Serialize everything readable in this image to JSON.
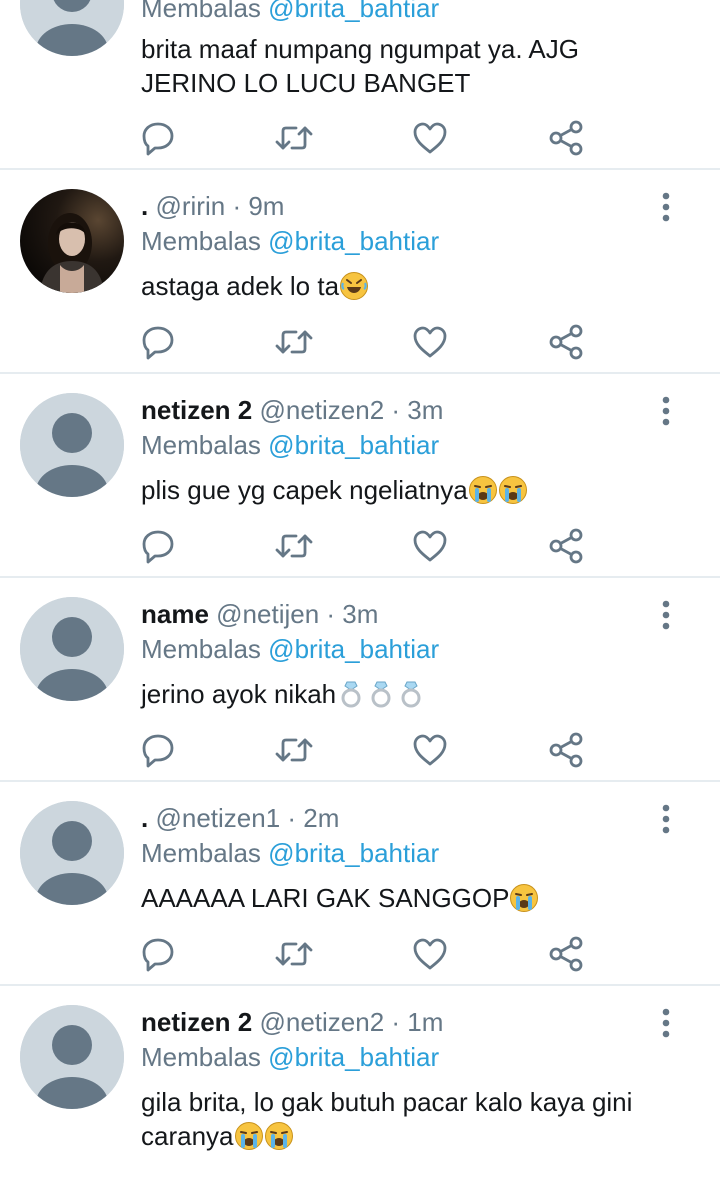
{
  "tweets": [
    {
      "display_name": "",
      "handle": "@brita_bahtiar",
      "time": "",
      "reply_prefix": "Membalas",
      "reply_to": "@brita_bahtiar",
      "text": "brita maaf numpang ngumpat ya. AJG JERINO LO LUCU BANGET",
      "emojis": [],
      "avatar": "default-avatar"
    },
    {
      "display_name": ".",
      "handle": "@ririn",
      "time": "· 9m",
      "reply_prefix": "Membalas",
      "reply_to": "@brita_bahtiar",
      "text": "astaga adek lo ta",
      "emojis": [
        "rolling-laughing"
      ],
      "avatar": "photo-avatar"
    },
    {
      "display_name": "netizen 2",
      "handle": "@netizen2",
      "time": "· 3m",
      "reply_prefix": "Membalas",
      "reply_to": "@brita_bahtiar",
      "text": "plis gue yg capek ngeliatnya",
      "emojis": [
        "crying",
        "crying"
      ],
      "avatar": "default-avatar"
    },
    {
      "display_name": "name",
      "handle": "@netijen",
      "time": "· 3m",
      "reply_prefix": "Membalas",
      "reply_to": "@brita_bahtiar",
      "text": "jerino ayok nikah",
      "emojis": [
        "ring",
        "ring",
        "ring"
      ],
      "avatar": "default-avatar"
    },
    {
      "display_name": ".",
      "handle": "@netizen1",
      "time": "· 2m",
      "reply_prefix": "Membalas",
      "reply_to": "@brita_bahtiar",
      "text": "AAAAAA LARI GAK SANGGOP",
      "emojis": [
        "crying"
      ],
      "avatar": "default-avatar"
    },
    {
      "display_name": "netizen 2",
      "handle": "@netizen2",
      "time": "· 1m",
      "reply_prefix": "Membalas",
      "reply_to": "@brita_bahtiar",
      "text": "gila brita, lo gak butuh pacar kalo kaya gini caranya",
      "emojis": [
        "crying",
        "crying"
      ],
      "avatar": "default-avatar"
    }
  ],
  "action_icons": [
    "reply-icon",
    "retweet-icon",
    "like-icon",
    "share-icon"
  ],
  "colors": {
    "text": "#14171a",
    "secondary": "#657786",
    "mention": "#2b9fd9",
    "divider": "#e6ecf0",
    "avatar_bg": "#ccd6dd",
    "avatar_fg": "#657786"
  }
}
